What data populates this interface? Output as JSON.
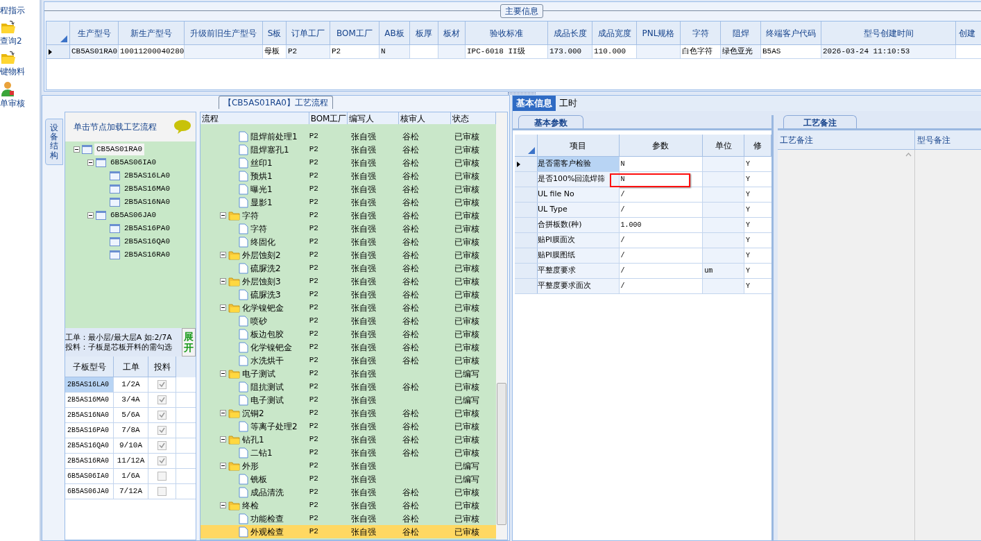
{
  "sidebar": {
    "items": [
      {
        "label": "程指示",
        "kind": "text"
      },
      {
        "label": "查询2",
        "kind": "folder"
      },
      {
        "label": "键物料",
        "kind": "folder"
      },
      {
        "label": "单审核",
        "kind": "person"
      }
    ]
  },
  "main_info": {
    "title": "主要信息",
    "columns": [
      "生产型号",
      "新生产型号",
      "升级前旧生产型号",
      "S板",
      "订单工厂",
      "BOM工厂",
      "AB板",
      "板厚",
      "板材",
      "验收标准",
      "成品长度",
      "成品宽度",
      "PNL规格",
      "字符",
      "阻焊",
      "终端客户代码",
      "型号创建时间",
      "创建"
    ],
    "rows": [
      {
        "selected": true,
        "cells": [
          "CB5AS01RA0",
          "10011200040280",
          null,
          "母板",
          "P2",
          "P2",
          "N",
          null,
          null,
          "IPC-6018 II级",
          "173.000",
          "110.000",
          null,
          "白色字符",
          "绿色亚光",
          "B5AS",
          "2026-03-24 11:10:53",
          null
        ]
      }
    ]
  },
  "process_panel": {
    "title": "【CB5AS01RA0】工艺流程",
    "side_tab": "设备结构",
    "tree_hint": "单击节点加载工艺流程",
    "tree": [
      {
        "label": "CB5AS01RA0",
        "selected": true,
        "expanded": true,
        "children": [
          {
            "label": "6B5AS06IA0",
            "selected": false,
            "expanded": true,
            "children": [
              {
                "label": "2B5AS16LA0",
                "selected": false
              },
              {
                "label": "2B5AS16MA0",
                "selected": false
              },
              {
                "label": "2B5AS16NA0",
                "selected": false
              }
            ]
          },
          {
            "label": "6B5AS06JA0",
            "selected": false,
            "expanded": true,
            "children": [
              {
                "label": "2B5AS16PA0",
                "selected": false
              },
              {
                "label": "2B5AS16QA0",
                "selected": false
              },
              {
                "label": "2B5AS16RA0",
                "selected": false
              }
            ]
          }
        ]
      }
    ],
    "notes": [
      "工单：最小层/最大层A 如:2/7A",
      "投料：子板是芯板开料的需勾选"
    ],
    "expand_button": "展开",
    "sub_boards": {
      "columns": [
        "子板型号",
        "工单",
        "投料"
      ],
      "rows": [
        {
          "model": "2B5AS16LA0",
          "order": "1/2A",
          "checked": true,
          "selected": true
        },
        {
          "model": "2B5AS16MA0",
          "order": "3/4A",
          "checked": true,
          "selected": false
        },
        {
          "model": "2B5AS16NA0",
          "order": "5/6A",
          "checked": true,
          "selected": false
        },
        {
          "model": "2B5AS16PA0",
          "order": "7/8A",
          "checked": true,
          "selected": false
        },
        {
          "model": "2B5AS16QA0",
          "order": "9/10A",
          "checked": true,
          "selected": false
        },
        {
          "model": "2B5AS16RA0",
          "order": "11/12A",
          "checked": true,
          "selected": false
        },
        {
          "model": "6B5AS06IA0",
          "order": "1/6A",
          "checked": false,
          "selected": false
        },
        {
          "model": "6B5AS06JA0",
          "order": "7/12A",
          "checked": false,
          "selected": false
        }
      ]
    },
    "flow": {
      "columns": [
        "流程",
        "BOM工厂",
        "编写人",
        "核审人",
        "状态"
      ],
      "groups": [
        {
          "children": [
            {
              "name": "阻焊前处理1",
              "bom": "P2",
              "writer": "张自强",
              "reviewer": "谷松",
              "status": "已审核",
              "selected": false
            },
            {
              "name": "阻焊塞孔1",
              "bom": "P2",
              "writer": "张自强",
              "reviewer": "谷松",
              "status": "已审核",
              "selected": false
            },
            {
              "name": "丝印1",
              "bom": "P2",
              "writer": "张自强",
              "reviewer": "谷松",
              "status": "已审核",
              "selected": false
            },
            {
              "name": "预烘1",
              "bom": "P2",
              "writer": "张自强",
              "reviewer": "谷松",
              "status": "已审核",
              "selected": false
            },
            {
              "name": "曝光1",
              "bom": "P2",
              "writer": "张自强",
              "reviewer": "谷松",
              "status": "已审核",
              "selected": false
            },
            {
              "name": "显影1",
              "bom": "P2",
              "writer": "张自强",
              "reviewer": "谷松",
              "status": "已审核",
              "selected": false
            }
          ]
        },
        {
          "name": "字符",
          "bom": "P2",
          "writer": "张自强",
          "reviewer": "谷松",
          "status": "已审核",
          "selected": false,
          "expanded": true,
          "children": [
            {
              "name": "字符",
              "bom": "P2",
              "writer": "张自强",
              "reviewer": "谷松",
              "status": "已审核",
              "selected": false
            },
            {
              "name": "终固化",
              "bom": "P2",
              "writer": "张自强",
              "reviewer": "谷松",
              "status": "已审核",
              "selected": false
            }
          ]
        },
        {
          "name": "外层蚀刻2",
          "bom": "P2",
          "writer": "张自强",
          "reviewer": "谷松",
          "status": "已审核",
          "selected": false,
          "expanded": true,
          "children": [
            {
              "name": "硫脲洗2",
              "bom": "P2",
              "writer": "张自强",
              "reviewer": "谷松",
              "status": "已审核",
              "selected": false
            }
          ]
        },
        {
          "name": "外层蚀刻3",
          "bom": "P2",
          "writer": "张自强",
          "reviewer": "谷松",
          "status": "已审核",
          "selected": false,
          "expanded": true,
          "children": [
            {
              "name": "硫脲洗3",
              "bom": "P2",
              "writer": "张自强",
              "reviewer": "谷松",
              "status": "已审核",
              "selected": false
            }
          ]
        },
        {
          "name": "化学镍钯金",
          "bom": "P2",
          "writer": "张自强",
          "reviewer": "谷松",
          "status": "已审核",
          "selected": false,
          "expanded": true,
          "children": [
            {
              "name": "喷砂",
              "bom": "P2",
              "writer": "张自强",
              "reviewer": "谷松",
              "status": "已审核",
              "selected": false
            },
            {
              "name": "板边包胶",
              "bom": "P2",
              "writer": "张自强",
              "reviewer": "谷松",
              "status": "已审核",
              "selected": false
            },
            {
              "name": "化学镍钯金",
              "bom": "P2",
              "writer": "张自强",
              "reviewer": "谷松",
              "status": "已审核",
              "selected": false
            },
            {
              "name": "水洗烘干",
              "bom": "P2",
              "writer": "张自强",
              "reviewer": "谷松",
              "status": "已审核",
              "selected": false
            }
          ]
        },
        {
          "name": "电子测试",
          "bom": "P2",
          "writer": "张自强",
          "status": "已编写",
          "selected": false,
          "expanded": true,
          "children": [
            {
              "name": "阻抗测试",
              "bom": "P2",
              "writer": "张自强",
              "reviewer": "谷松",
              "status": "已审核",
              "selected": false
            },
            {
              "name": "电子测试",
              "bom": "P2",
              "writer": "张自强",
              "status": "已编写",
              "selected": false
            }
          ]
        },
        {
          "name": "沉铜2",
          "bom": "P2",
          "writer": "张自强",
          "reviewer": "谷松",
          "status": "已审核",
          "selected": false,
          "expanded": true,
          "children": [
            {
              "name": "等离子处理2",
              "bom": "P2",
              "writer": "张自强",
              "reviewer": "谷松",
              "status": "已审核",
              "selected": false
            }
          ]
        },
        {
          "name": "钻孔1",
          "bom": "P2",
          "writer": "张自强",
          "reviewer": "谷松",
          "status": "已审核",
          "selected": false,
          "expanded": true,
          "children": [
            {
              "name": "二钻1",
              "bom": "P2",
              "writer": "张自强",
              "reviewer": "谷松",
              "status": "已审核",
              "selected": false
            }
          ]
        },
        {
          "name": "外形",
          "bom": "P2",
          "writer": "张自强",
          "status": "已编写",
          "selected": false,
          "expanded": true,
          "children": [
            {
              "name": "铣板",
              "bom": "P2",
              "writer": "张自强",
              "status": "已编写",
              "selected": false
            },
            {
              "name": "成品清洗",
              "bom": "P2",
              "writer": "张自强",
              "reviewer": "谷松",
              "status": "已审核",
              "selected": false
            }
          ]
        },
        {
          "name": "终检",
          "bom": "P2",
          "writer": "张自强",
          "reviewer": "谷松",
          "status": "已审核",
          "selected": false,
          "expanded": true,
          "children": [
            {
              "name": "功能检查",
              "bom": "P2",
              "writer": "张自强",
              "reviewer": "谷松",
              "status": "已审核",
              "selected": false
            },
            {
              "name": "外观检查",
              "bom": "P2",
              "writer": "张自强",
              "reviewer": "谷松",
              "status": "已审核",
              "selected": true
            }
          ]
        }
      ]
    }
  },
  "right_panel": {
    "tabs": [
      {
        "label": "基本信息",
        "selected": true
      },
      {
        "label": "工时",
        "selected": false
      }
    ],
    "params": {
      "tab": "基本参数",
      "columns": [
        "项目",
        "参数",
        "单位",
        "修"
      ],
      "rows": [
        {
          "item": "是否需客户检验",
          "value": "N",
          "modify": "Y",
          "selected": true
        },
        {
          "item": "是否100%回流焊筛",
          "value": "N",
          "modify": "Y",
          "selected": false,
          "highlighted": true
        },
        {
          "item": "UL file No",
          "value": "/",
          "modify": "Y",
          "selected": false
        },
        {
          "item": "UL Type",
          "value": "/",
          "modify": "Y",
          "selected": false
        },
        {
          "item": "合拼板数(种)",
          "value": "1.000",
          "modify": "Y",
          "selected": false
        },
        {
          "item": "贴PI膜面次",
          "value": "/",
          "modify": "Y",
          "selected": false
        },
        {
          "item": "贴PI膜图纸",
          "value": "/",
          "modify": "Y",
          "selected": false
        },
        {
          "item": "平整度要求",
          "value": "/",
          "unit": "um",
          "modify": "Y",
          "selected": false
        },
        {
          "item": "平整度要求面次",
          "value": "/",
          "modify": "Y",
          "selected": false
        }
      ]
    },
    "notes": {
      "tab": "工艺备注",
      "columns": [
        "工艺备注",
        "型号备注"
      ]
    }
  }
}
